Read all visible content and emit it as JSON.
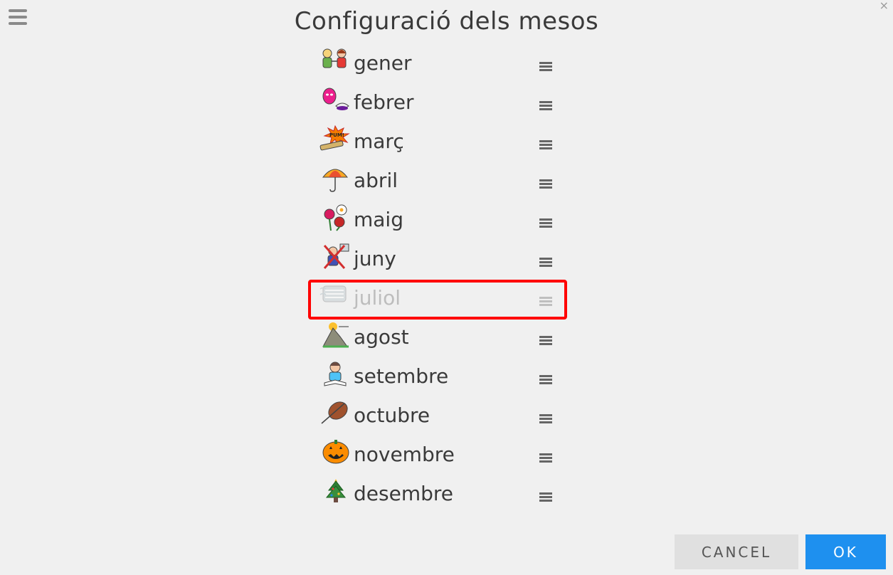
{
  "header": {
    "title": "Configuració dels mesos",
    "close_glyph": "×"
  },
  "months": [
    {
      "label": "gener",
      "icon": "people-greeting-icon",
      "enabled": true
    },
    {
      "label": "febrer",
      "icon": "carnival-mask-icon",
      "enabled": true
    },
    {
      "label": "març",
      "icon": "firecracker-pum-icon",
      "pum_text": "PUM!",
      "enabled": true
    },
    {
      "label": "abril",
      "icon": "umbrella-icon",
      "enabled": true
    },
    {
      "label": "maig",
      "icon": "flowers-icon",
      "enabled": true
    },
    {
      "label": "juny",
      "icon": "no-school-icon",
      "enabled": true
    },
    {
      "label": "juliol",
      "icon": "wind-heat-icon",
      "enabled": false,
      "highlighted": true
    },
    {
      "label": "agost",
      "icon": "mountain-sun-icon",
      "enabled": true
    },
    {
      "label": "setembre",
      "icon": "child-reading-icon",
      "enabled": true
    },
    {
      "label": "octubre",
      "icon": "autumn-leaf-icon",
      "enabled": true
    },
    {
      "label": "novembre",
      "icon": "pumpkin-icon",
      "enabled": true
    },
    {
      "label": "desembre",
      "icon": "christmas-tree-icon",
      "enabled": true
    }
  ],
  "footer": {
    "cancel_label": "CANCEL",
    "ok_label": "OK"
  },
  "colors": {
    "accent": "#1e90ef",
    "highlight": "#ff0000",
    "background": "#f0f0f0"
  }
}
